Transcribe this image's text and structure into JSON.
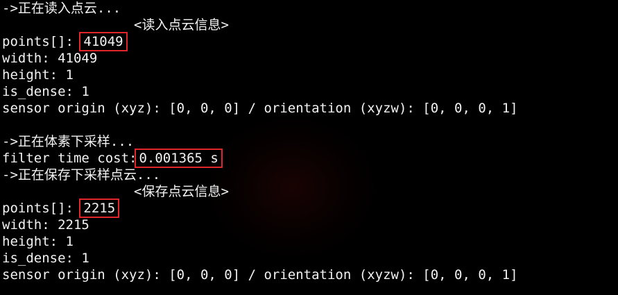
{
  "colors": {
    "background": "#000000",
    "text": "#f2f2f2",
    "highlight_box": "#e0262a"
  },
  "lines": {
    "l1": "->正在读入点云...",
    "l2": "<读入点云信息>",
    "l3_label": "points[]: ",
    "l3_value": "41049",
    "l4": "width: 41049",
    "l5": "height: 1",
    "l6": "is_dense: 1",
    "l7": "sensor origin (xyz): [0, 0, 0] / orientation (xyzw): [0, 0, 0, 1]",
    "l9": "->正在体素下采样...",
    "l10_label": "filter time cost:",
    "l10_value": "0.001365 s",
    "l11": "->正在保存下采样点云...",
    "l12": "<保存点云信息>",
    "l13_label": "points[]: ",
    "l13_value": "2215",
    "l14": "width: 2215",
    "l15": "height: 1",
    "l16": "is_dense: 1",
    "l17": "sensor origin (xyz): [0, 0, 0] / orientation (xyzw): [0, 0, 0, 1]"
  }
}
